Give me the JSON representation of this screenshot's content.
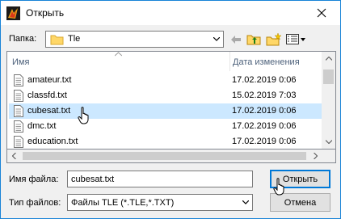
{
  "window": {
    "title": "Открыть"
  },
  "folder": {
    "label": "Папка:",
    "value": "Tle"
  },
  "toolbar": {
    "back": "back-arrow-icon",
    "up": "up-folder-icon",
    "new_folder": "new-folder-icon",
    "view_menu": "view-menu-icon"
  },
  "list": {
    "columns": {
      "name": "Имя",
      "date": "Дата изменения"
    },
    "rows": [
      {
        "name": "amateur.txt",
        "date": "17.02.2019 0:06"
      },
      {
        "name": "classfd.txt",
        "date": "15.02.2019 7:03"
      },
      {
        "name": "cubesat.txt",
        "date": "17.02.2019 0:06",
        "selected": true
      },
      {
        "name": "dmc.txt",
        "date": "17.02.2019 0:06"
      },
      {
        "name": "education.txt",
        "date": "17.02.2019 0:06"
      }
    ]
  },
  "filename": {
    "label": "Имя файла:",
    "value": "cubesat.txt"
  },
  "filetype": {
    "label": "Тип файлов:",
    "value": "Файлы TLE (*.TLE,*.TXT)"
  },
  "buttons": {
    "open": "Открыть",
    "cancel": "Отмена"
  },
  "colors": {
    "selection": "#cce8ff",
    "accent": "#0078d7",
    "header_text": "#4c607a"
  }
}
